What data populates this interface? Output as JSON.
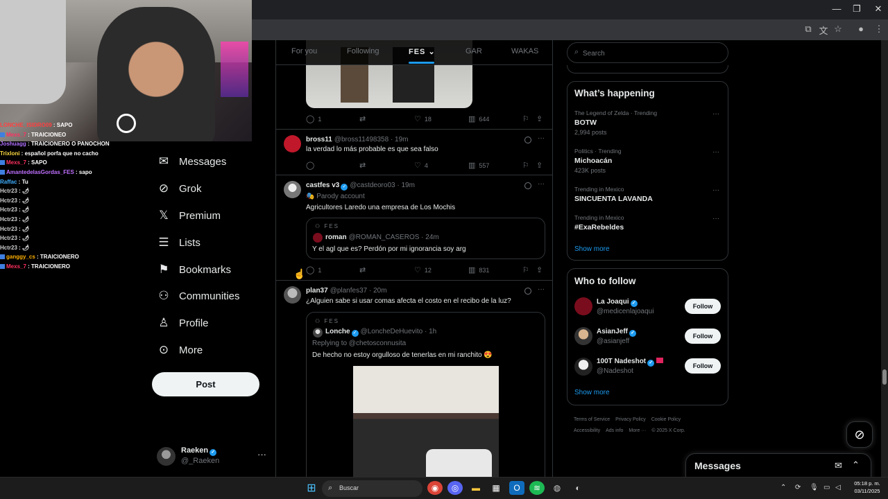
{
  "chat": [
    {
      "user": "LONCHE_ISIDRO09",
      "color": "#ff4040",
      "msg": "SAPO",
      "badge": false
    },
    {
      "user": "Mexs_7",
      "color": "#ff3060",
      "msg": "TRAICIONEO",
      "badge": true
    },
    {
      "user": "Joshuagg",
      "color": "#b070ff",
      "msg": "TRAICIONERO O PANOCHON",
      "badge": false
    },
    {
      "user": "Trixloni",
      "color": "#ffdc40",
      "msg": "español porfa que no cacho",
      "badge": false
    },
    {
      "user": "Mexs_7",
      "color": "#ff3060",
      "msg": "SAPO",
      "badge": true
    },
    {
      "user": "AmantedelasGordas_FES",
      "color": "#c070ff",
      "msg": "sapo",
      "badge": true
    },
    {
      "user": "Raffac",
      "color": "#40b0ff",
      "msg": "Tu",
      "badge": false
    },
    {
      "user": "Hctr23",
      "color": "#d0d0d0",
      "msg": "🌶",
      "badge": false
    },
    {
      "user": "Hctr23",
      "color": "#d0d0d0",
      "msg": "🌶",
      "badge": false
    },
    {
      "user": "Hctr23",
      "color": "#d0d0d0",
      "msg": "🌶",
      "badge": false
    },
    {
      "user": "Hctr23",
      "color": "#d0d0d0",
      "msg": "🌶",
      "badge": false
    },
    {
      "user": "Hctr23",
      "color": "#d0d0d0",
      "msg": "🌶",
      "badge": false
    },
    {
      "user": "Hctr23",
      "color": "#d0d0d0",
      "msg": "🌶",
      "badge": false
    },
    {
      "user": "Hctr23",
      "color": "#d0d0d0",
      "msg": "🌶",
      "badge": false
    },
    {
      "user": "ganggy_cs",
      "color": "#ffb000",
      "msg": "TRAICIONERO",
      "badge": true
    },
    {
      "user": "Mexs_7",
      "color": "#ff3060",
      "msg": "TRAICIONERO",
      "badge": true
    }
  ],
  "nav": {
    "messages": "Messages",
    "grok": "Grok",
    "premium": "Premium",
    "lists": "Lists",
    "bookmarks": "Bookmarks",
    "communities": "Communities",
    "profile": "Profile",
    "more": "More",
    "post": "Post"
  },
  "account": {
    "name": "Raeken",
    "handle": "@_Raeken"
  },
  "tabs": {
    "for_you": "For you",
    "following": "Following",
    "fes": "FES",
    "gar": "GAR",
    "wakas": "WAKAS"
  },
  "tweets": {
    "t0": {
      "replies": "1",
      "reposts": "",
      "likes": "18",
      "views": "644"
    },
    "t1": {
      "name": "bross11",
      "handle": "@bross11498358 · 19m",
      "text": "la verdad lo más probable es que sea falso",
      "replies": "",
      "reposts": "",
      "likes": "4",
      "views": "557"
    },
    "t2": {
      "name": "castfes v3",
      "handle": "@castdeoro03 · 19m",
      "sub": "Parody account",
      "text": "Agricultores Laredo una empresa de Los Mochis",
      "quote": {
        "community": "FES",
        "name": "roman",
        "handle": "@ROMAN_CASEROS · 24m",
        "text": "Y el agl que es? Perdón por mi ignorancia soy arg"
      },
      "replies": "1",
      "reposts": "",
      "likes": "12",
      "views": "831"
    },
    "t3": {
      "name": "plan37",
      "handle": "@planfes37 · 20m",
      "text": "¿Alguien sabe si usar comas afecta el costo en el recibo de la luz?",
      "quote": {
        "community": "FES",
        "name": "Lonche",
        "handle": "@LoncheDeHuevito · 1h",
        "reply_to": "Replying to @chetosconnusita",
        "text": "De hecho no estoy orgulloso de tenerlas en mi ranchito 😍"
      }
    }
  },
  "search": {
    "placeholder": "Search"
  },
  "trending": {
    "title": "What’s happening",
    "items": [
      {
        "context": "The Legend of Zelda · Trending",
        "name": "BOTW",
        "posts": "2,994 posts"
      },
      {
        "context": "Politics · Trending",
        "name": "Michoacán",
        "posts": "423K posts"
      },
      {
        "context": "Trending in Mexico",
        "name": "SINCUENTA LAVANDA",
        "posts": ""
      },
      {
        "context": "Trending in Mexico",
        "name": "#ExaRebeldes",
        "posts": ""
      }
    ],
    "show_more": "Show more"
  },
  "who_to_follow": {
    "title": "Who to follow",
    "items": [
      {
        "name": "La Joaqui",
        "handle": "@medicenlajoaqui",
        "button": "Follow"
      },
      {
        "name": "AsianJeff",
        "handle": "@asianjeff",
        "button": "Follow"
      },
      {
        "name": "100T Nadeshot",
        "handle": "@Nadeshot",
        "button": "Follow"
      }
    ],
    "show_more": "Show more"
  },
  "footer": {
    "terms": "Terms of Service",
    "privacy": "Privacy Policy",
    "cookie": "Cookie Policy",
    "accessibility": "Accessibility",
    "ads": "Ads info",
    "more": "More ···",
    "copyright": "© 2025 X Corp."
  },
  "messages_drawer": {
    "title": "Messages"
  },
  "taskbar": {
    "search_placeholder": "Buscar",
    "time": "05:18 p. m.",
    "date": "03/11/2025"
  },
  "colors": {
    "accent": "#1d9bf0",
    "background": "#000000",
    "border": "#2f3336",
    "muted": "#71767b"
  }
}
